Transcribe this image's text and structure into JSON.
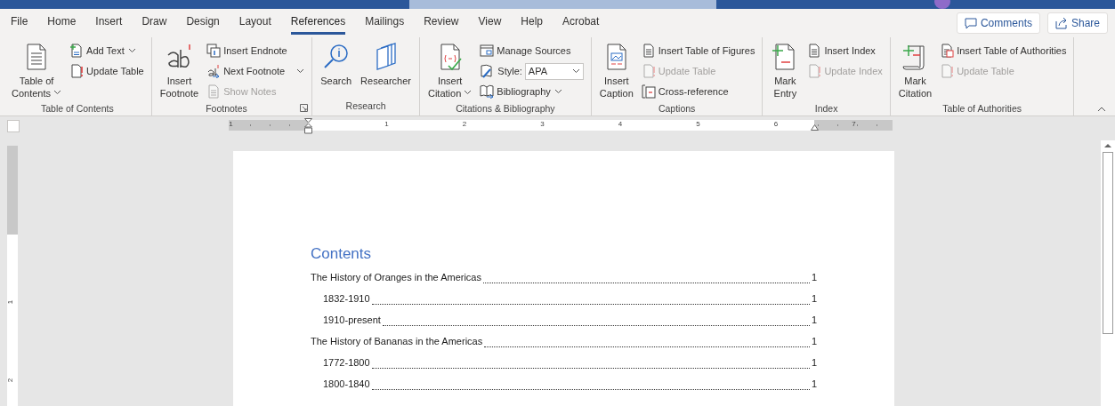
{
  "tabs": [
    {
      "label": "File",
      "selected": false
    },
    {
      "label": "Home",
      "selected": false
    },
    {
      "label": "Insert",
      "selected": false
    },
    {
      "label": "Draw",
      "selected": false
    },
    {
      "label": "Design",
      "selected": false
    },
    {
      "label": "Layout",
      "selected": false
    },
    {
      "label": "References",
      "selected": true
    },
    {
      "label": "Mailings",
      "selected": false
    },
    {
      "label": "Review",
      "selected": false
    },
    {
      "label": "View",
      "selected": false
    },
    {
      "label": "Help",
      "selected": false
    },
    {
      "label": "Acrobat",
      "selected": false
    }
  ],
  "header_buttons": [
    {
      "label": "Comments"
    },
    {
      "label": "Share"
    }
  ],
  "ribbon_groups": [
    {
      "label": "Table of Contents",
      "columns": [
        {
          "kind": "large",
          "lines": [
            "Table of",
            "Contents"
          ],
          "dropdown": true
        },
        {
          "kind": "stack",
          "items": [
            {
              "kind": "button",
              "label": "Add Text",
              "dropdown": true
            },
            {
              "kind": "button",
              "label": "Update Table"
            }
          ]
        }
      ]
    },
    {
      "label": "Footnotes",
      "launcher": true,
      "columns": [
        {
          "kind": "large",
          "lines": [
            "Insert",
            "Footnote"
          ]
        },
        {
          "kind": "stack",
          "items": [
            {
              "kind": "button",
              "label": "Insert Endnote"
            },
            {
              "kind": "button",
              "label": "Next Footnote",
              "dropdown": true
            },
            {
              "kind": "button",
              "label": "Show Notes",
              "disabled": true
            }
          ]
        }
      ]
    },
    {
      "label": "Research",
      "columns": [
        {
          "kind": "large",
          "lines": [
            "Search"
          ]
        },
        {
          "kind": "large",
          "lines": [
            "Researcher"
          ]
        }
      ]
    },
    {
      "label": "Citations & Bibliography",
      "columns": [
        {
          "kind": "large",
          "lines": [
            "Insert",
            "Citation"
          ],
          "dropdown": true
        },
        {
          "kind": "stack",
          "items": [
            {
              "kind": "button",
              "label": "Manage Sources"
            },
            {
              "kind": "combo",
              "label": "Style:",
              "value": "APA"
            },
            {
              "kind": "button",
              "label": "Bibliography",
              "dropdown": true
            }
          ]
        }
      ]
    },
    {
      "label": "Captions",
      "columns": [
        {
          "kind": "large",
          "lines": [
            "Insert",
            "Caption"
          ]
        },
        {
          "kind": "stack",
          "items": [
            {
              "kind": "button",
              "label": "Insert Table of Figures"
            },
            {
              "kind": "button",
              "label": "Update Table",
              "disabled": true
            },
            {
              "kind": "button",
              "label": "Cross-reference"
            }
          ]
        }
      ]
    },
    {
      "label": "Index",
      "columns": [
        {
          "kind": "large",
          "lines": [
            "Mark",
            "Entry"
          ]
        },
        {
          "kind": "stack",
          "items": [
            {
              "kind": "button",
              "label": "Insert Index"
            },
            {
              "kind": "button",
              "label": "Update Index",
              "disabled": true
            }
          ]
        }
      ]
    },
    {
      "label": "Table of Authorities",
      "columns": [
        {
          "kind": "large",
          "lines": [
            "Mark",
            "Citation"
          ]
        },
        {
          "kind": "stack",
          "items": [
            {
              "kind": "button",
              "label": "Insert Table of Authorities"
            },
            {
              "kind": "button",
              "label": "Update Table",
              "disabled": true
            }
          ]
        }
      ]
    }
  ],
  "ruler": {
    "labels": [
      "1",
      "1",
      "2",
      "3",
      "4",
      "5",
      "6",
      "7"
    ]
  },
  "vertical_ruler": {
    "labels": [
      "1",
      "2"
    ]
  },
  "document": {
    "heading": "Contents",
    "entries": [
      {
        "text": "The History of Oranges in the Americas",
        "page": "1",
        "children": [
          {
            "text": "1832-1910",
            "page": "1"
          },
          {
            "text": "1910-present",
            "page": "1"
          }
        ]
      },
      {
        "text": "The History of Bananas in the Americas",
        "page": "1",
        "children": [
          {
            "text": "1772-1800",
            "page": "1"
          },
          {
            "text": "1800-1840",
            "page": "1"
          }
        ]
      }
    ]
  }
}
